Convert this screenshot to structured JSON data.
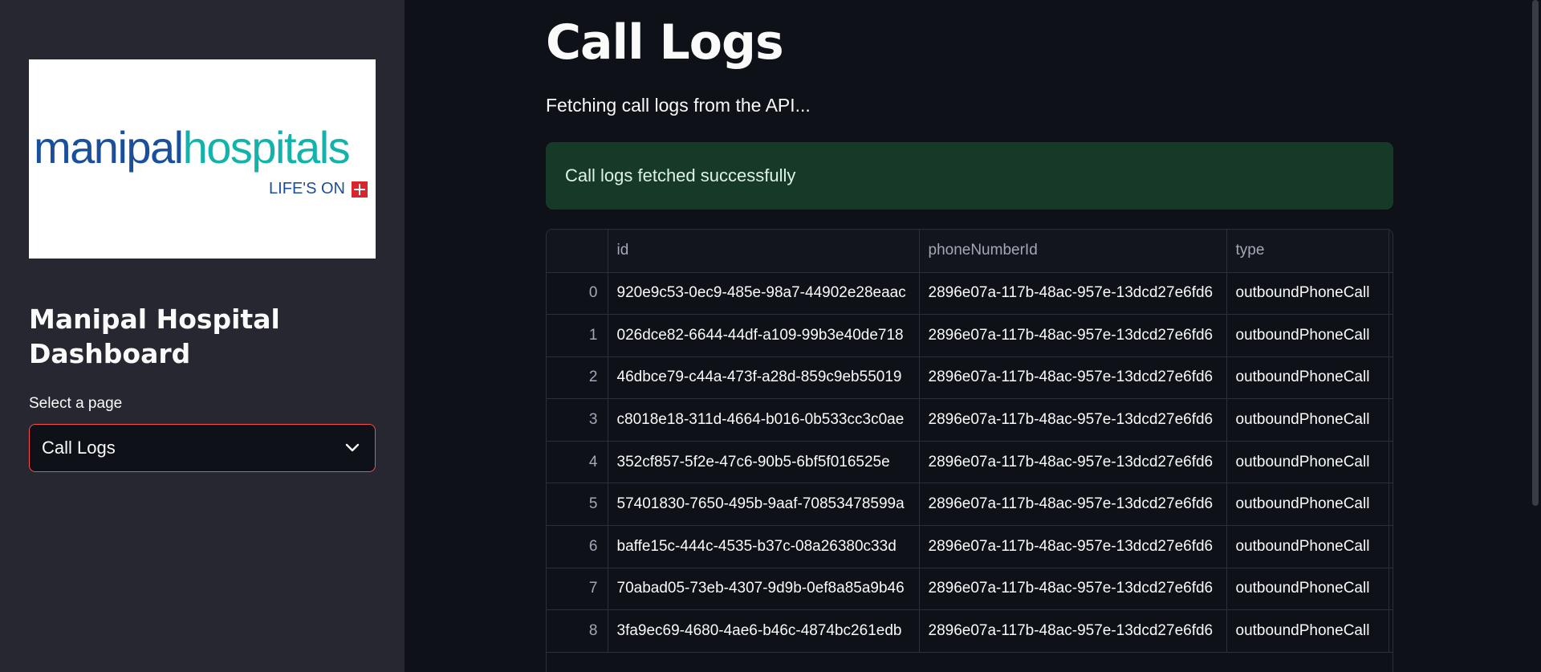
{
  "sidebar": {
    "logo": {
      "word_part1": "manipal",
      "word_part2": "hospitals",
      "tagline": "LIFE'S ON"
    },
    "title": "Manipal Hospital Dashboard",
    "select_label": "Select a page",
    "select_value": "Call Logs",
    "chevron_icon": "chevron-down-icon"
  },
  "main": {
    "title": "Call Logs",
    "fetching_text": "Fetching call logs from the API...",
    "success_message": "Call logs fetched successfully",
    "table": {
      "columns": [
        "",
        "id",
        "phoneNumberId",
        "type"
      ],
      "rows": [
        {
          "index": "0",
          "id": "920e9c53-0ec9-485e-98a7-44902e28eaac",
          "phoneNumberId": "2896e07a-117b-48ac-957e-13dcd27e6fd6",
          "type": "outboundPhoneCall"
        },
        {
          "index": "1",
          "id": "026dce82-6644-44df-a109-99b3e40de718",
          "phoneNumberId": "2896e07a-117b-48ac-957e-13dcd27e6fd6",
          "type": "outboundPhoneCall"
        },
        {
          "index": "2",
          "id": "46dbce79-c44a-473f-a28d-859c9eb55019",
          "phoneNumberId": "2896e07a-117b-48ac-957e-13dcd27e6fd6",
          "type": "outboundPhoneCall"
        },
        {
          "index": "3",
          "id": "c8018e18-311d-4664-b016-0b533cc3c0ae",
          "phoneNumberId": "2896e07a-117b-48ac-957e-13dcd27e6fd6",
          "type": "outboundPhoneCall"
        },
        {
          "index": "4",
          "id": "352cf857-5f2e-47c6-90b5-6bf5f016525e",
          "phoneNumberId": "2896e07a-117b-48ac-957e-13dcd27e6fd6",
          "type": "outboundPhoneCall"
        },
        {
          "index": "5",
          "id": "57401830-7650-495b-9aaf-70853478599a",
          "phoneNumberId": "2896e07a-117b-48ac-957e-13dcd27e6fd6",
          "type": "outboundPhoneCall"
        },
        {
          "index": "6",
          "id": "baffe15c-444c-4535-b37c-08a26380c33d",
          "phoneNumberId": "2896e07a-117b-48ac-957e-13dcd27e6fd6",
          "type": "outboundPhoneCall"
        },
        {
          "index": "7",
          "id": "70abad05-73eb-4307-9d9b-0ef8a85a9b46",
          "phoneNumberId": "2896e07a-117b-48ac-957e-13dcd27e6fd6",
          "type": "outboundPhoneCall"
        },
        {
          "index": "8",
          "id": "3fa9ec69-4680-4ae6-b46c-4874bc261edb",
          "phoneNumberId": "2896e07a-117b-48ac-957e-13dcd27e6fd6",
          "type": "outboundPhoneCall"
        }
      ]
    }
  },
  "colors": {
    "sidebar_bg": "#262730",
    "main_bg": "#0e1117",
    "select_border": "#ff4b4b",
    "success_bg": "#173928",
    "logo_blue": "#1a4f9c",
    "logo_teal": "#13b3ab",
    "logo_red": "#d9262d"
  }
}
